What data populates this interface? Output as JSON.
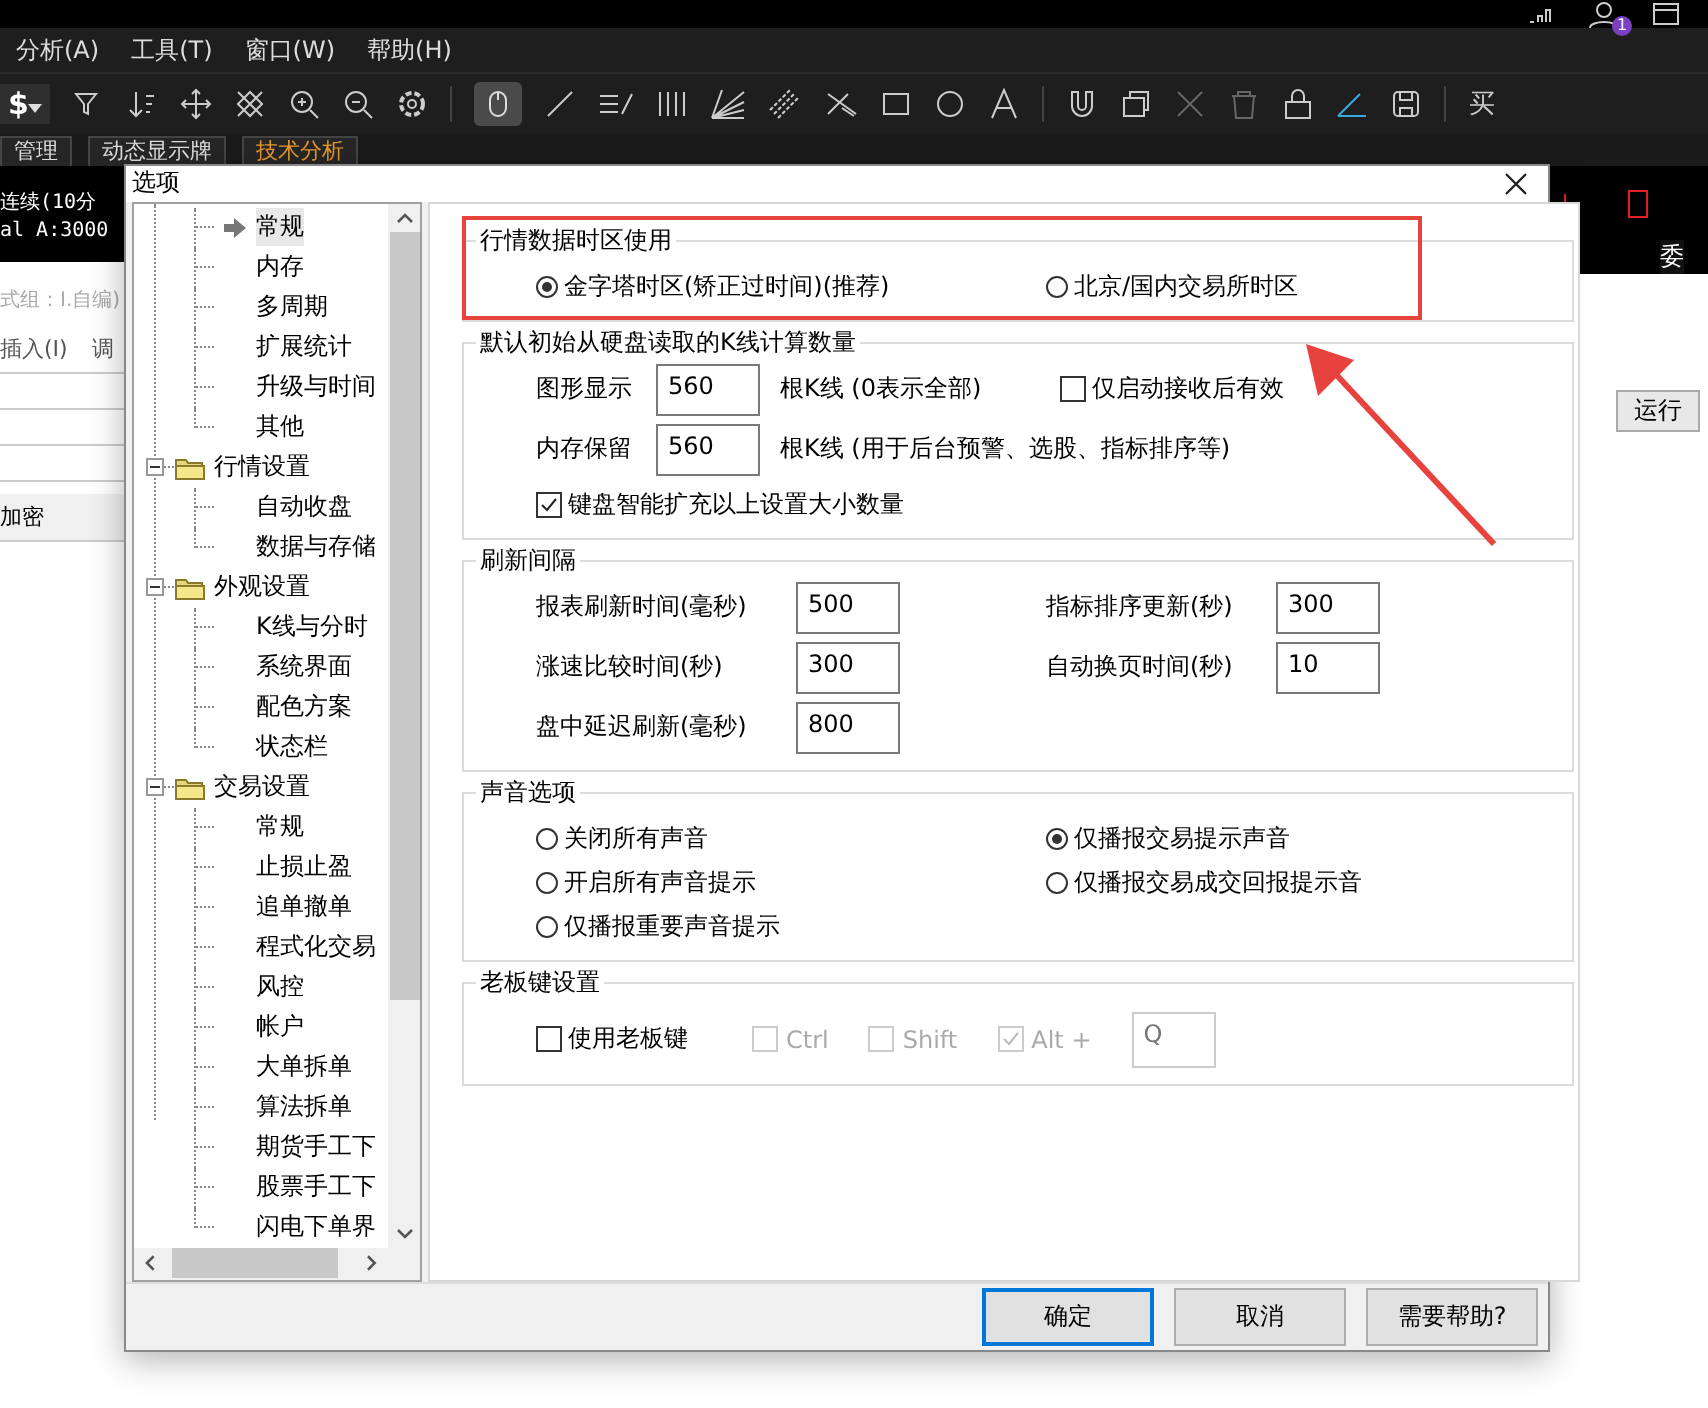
{
  "menu_bar": [
    "分析(A)",
    "工具(T)",
    "窗口(W)",
    "帮助(H)"
  ],
  "notification_badge": "1",
  "toolbar": {
    "currency": "$",
    "trailing": "买"
  },
  "app_tabs": [
    {
      "label": "管理",
      "selected": false
    },
    {
      "label": "动态显示牌",
      "selected": false
    },
    {
      "label": "技术分析",
      "selected": true
    }
  ],
  "background_left": {
    "quote_lines": [
      "连续(10分",
      "al A:3000"
    ],
    "group_text": "式组：I.自编)",
    "menu_items": [
      "插入(I)",
      "调"
    ],
    "row_text": "加密"
  },
  "background_right": {
    "label": "委",
    "run_button": "运行"
  },
  "dialog": {
    "title": "选项",
    "tree": [
      {
        "children": [
          {
            "label": "常规",
            "selected": true
          },
          {
            "label": "内存",
            "selected": false
          },
          {
            "label": "多周期",
            "selected": false
          },
          {
            "label": "扩展统计",
            "selected": false
          },
          {
            "label": "升级与时间",
            "selected": false
          },
          {
            "label": "其他",
            "selected": false
          }
        ]
      },
      {
        "label": "行情设置",
        "expanded": true,
        "children": [
          {
            "label": "自动收盘",
            "selected": false
          },
          {
            "label": "数据与存储",
            "selected": false
          }
        ]
      },
      {
        "label": "外观设置",
        "expanded": true,
        "children": [
          {
            "label": "K线与分时",
            "selected": false
          },
          {
            "label": "系统界面",
            "selected": false
          },
          {
            "label": "配色方案",
            "selected": false
          },
          {
            "label": "状态栏",
            "selected": false
          }
        ]
      },
      {
        "label": "交易设置",
        "expanded": true,
        "children": [
          {
            "label": "常规",
            "selected": false
          },
          {
            "label": "止损止盈",
            "selected": false
          },
          {
            "label": "追单撤单",
            "selected": false
          },
          {
            "label": "程式化交易",
            "selected": false
          },
          {
            "label": "风控",
            "selected": false
          },
          {
            "label": "帐户",
            "selected": false
          },
          {
            "label": "大单拆单",
            "selected": false
          },
          {
            "label": "算法拆单",
            "selected": false
          },
          {
            "label": "期货手工下",
            "selected": false
          },
          {
            "label": "股票手工下",
            "selected": false
          },
          {
            "label": "闪电下单界",
            "selected": false
          }
        ]
      }
    ],
    "groups": [
      {
        "kind": "radios",
        "title": "行情数据时区使用",
        "highlighted": true,
        "options": [
          {
            "label": "金字塔时区(矫正过时间)(推荐)",
            "selected": true
          },
          {
            "label": "北京/国内交易所时区",
            "selected": false
          }
        ]
      },
      {
        "kind": "kline",
        "title": "默认初始从硬盘读取的K线计算数量",
        "rows": [
          {
            "label": "图形显示",
            "value": "560",
            "suffix": "根K线 (0表示全部)",
            "option": {
              "label": "仅启动接收后有效",
              "checked": false
            }
          },
          {
            "label": "内存保留",
            "value": "560",
            "suffix": "根K线  (用于后台预警、选股、指标排序等)"
          }
        ],
        "checkbox": {
          "label": "键盘智能扩充以上设置大小数量",
          "checked": true
        }
      },
      {
        "kind": "intervals",
        "title": "刷新间隔",
        "fields": [
          {
            "label": "报表刷新时间(毫秒)",
            "value": "500"
          },
          {
            "label": "指标排序更新(秒)",
            "value": "300"
          },
          {
            "label": "涨速比较时间(秒)",
            "value": "300"
          },
          {
            "label": "自动换页时间(秒)",
            "value": "10"
          },
          {
            "label": "盘中延迟刷新(毫秒)",
            "value": "800"
          }
        ]
      },
      {
        "kind": "radios",
        "title": "声音选项",
        "highlighted": false,
        "options": [
          {
            "label": "关闭所有声音",
            "selected": false
          },
          {
            "label": "仅播报交易提示声音",
            "selected": true
          },
          {
            "label": "开启所有声音提示",
            "selected": false
          },
          {
            "label": "仅播报交易成交回报提示音",
            "selected": false
          },
          {
            "label": "仅播报重要声音提示",
            "selected": false
          }
        ]
      },
      {
        "kind": "hotkey",
        "title": "老板键设置",
        "options": [
          {
            "kind": "checkbox",
            "label": "使用老板键",
            "checked": false,
            "disabled": false
          },
          {
            "kind": "checkbox",
            "label": "Ctrl",
            "checked": false,
            "disabled": true
          },
          {
            "kind": "checkbox",
            "label": "Shift",
            "checked": false,
            "disabled": true
          },
          {
            "kind": "checkbox",
            "label": "Alt +",
            "checked": true,
            "disabled": true
          },
          {
            "kind": "field",
            "value": "Q",
            "disabled": true
          }
        ]
      }
    ],
    "buttons": [
      {
        "label": "确定",
        "default": true
      },
      {
        "label": "取消",
        "default": false
      },
      {
        "label": "需要帮助?",
        "default": false
      }
    ]
  }
}
